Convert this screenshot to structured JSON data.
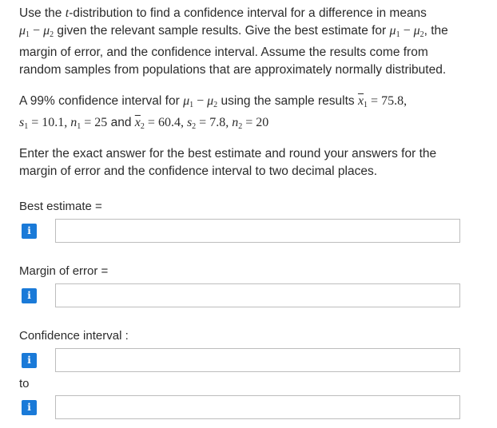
{
  "problem": {
    "intro": "Use the",
    "t_var": "t",
    "intro_2": "-distribution to find a confidence interval for a difference in means",
    "mu": "μ",
    "sub1": "1",
    "minus": " − ",
    "sub2": "2",
    "line2_a": "given the relevant sample results. Give the best estimate for",
    "line2_b": ", the",
    "line3": "margin of error, and the confidence interval. Assume the results come from",
    "line4": "random samples from populations that are approximately normally distributed."
  },
  "given": {
    "lead": "A 99% confidence interval for",
    "using": "using the sample results",
    "x": "x",
    "eq": " = ",
    "x1_val": "75.8,",
    "s": "s",
    "s1_val": "10.1,",
    "n": "n",
    "n1_val": "25",
    "and": "and",
    "x2_val": "60.4,",
    "s2_val": "7.8,",
    "n2_val": "20"
  },
  "instructions": {
    "line1": "Enter the exact answer for the best estimate and round your answers for the",
    "line2": "margin of error and the confidence interval to two decimal places."
  },
  "fields": {
    "best_estimate_label": "Best estimate =",
    "margin_label": "Margin of error =",
    "ci_label": "Confidence interval :",
    "to_label": "to",
    "info_glyph": "i"
  },
  "colors": {
    "info_button": "#1a7ad8",
    "input_border": "#bdbdbd"
  },
  "icons": {
    "info": "info-icon"
  }
}
